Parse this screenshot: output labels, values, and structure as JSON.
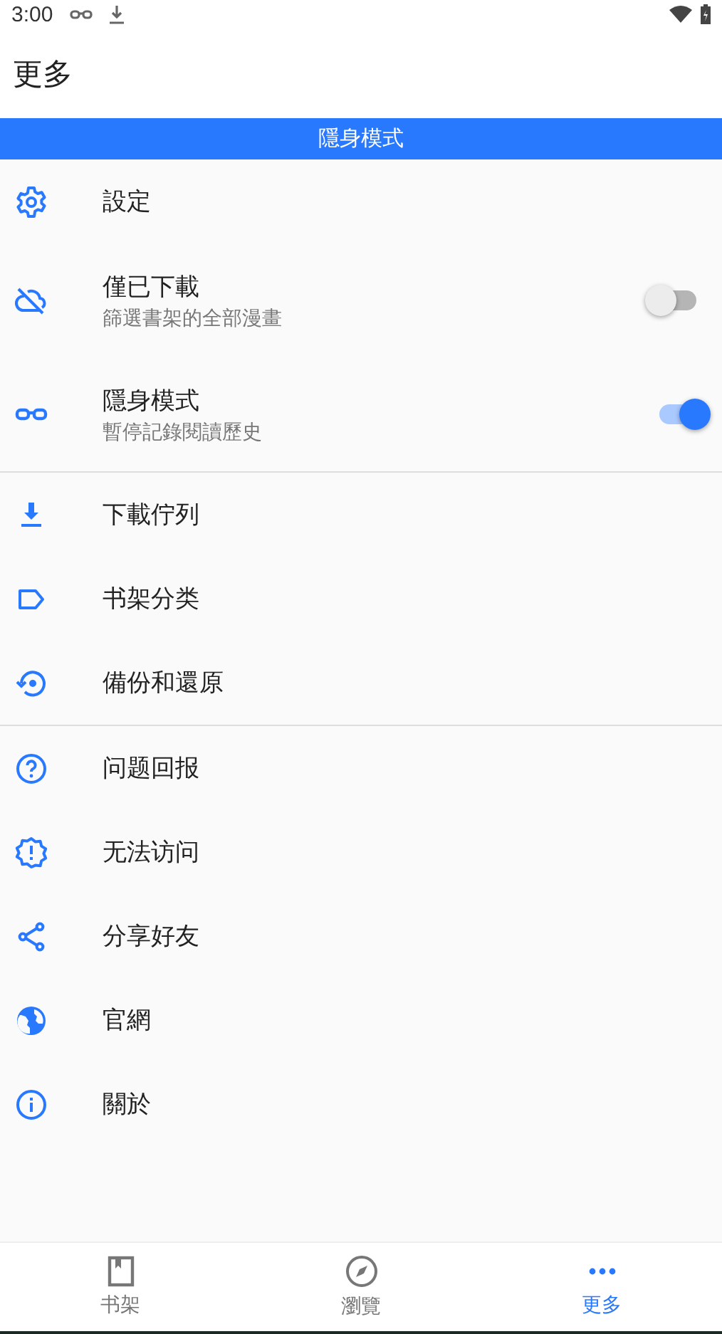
{
  "status_bar": {
    "time": "3:00"
  },
  "header": {
    "title": "更多"
  },
  "banner": {
    "text": "隱身模式"
  },
  "menu_groups": [
    {
      "items": [
        {
          "kind": "link",
          "label": "設定"
        },
        {
          "kind": "toggle",
          "label": "僅已下載",
          "subtitle": "篩選書架的全部漫畫",
          "on": false
        },
        {
          "kind": "toggle",
          "label": "隱身模式",
          "subtitle": "暫停記錄閱讀歷史",
          "on": true
        }
      ]
    },
    {
      "items": [
        {
          "kind": "link",
          "label": "下載佇列"
        },
        {
          "kind": "link",
          "label": "书架分类"
        },
        {
          "kind": "link",
          "label": "備份和還原"
        }
      ]
    },
    {
      "items": [
        {
          "kind": "link",
          "label": "问题回报"
        },
        {
          "kind": "link",
          "label": "无法访问"
        },
        {
          "kind": "link",
          "label": "分享好友"
        },
        {
          "kind": "link",
          "label": "官網"
        },
        {
          "kind": "link",
          "label": "關於"
        }
      ]
    }
  ],
  "bottom_nav": [
    {
      "label": "书架",
      "selected": false
    },
    {
      "label": "瀏覽",
      "selected": false
    },
    {
      "label": "更多",
      "selected": true
    }
  ]
}
